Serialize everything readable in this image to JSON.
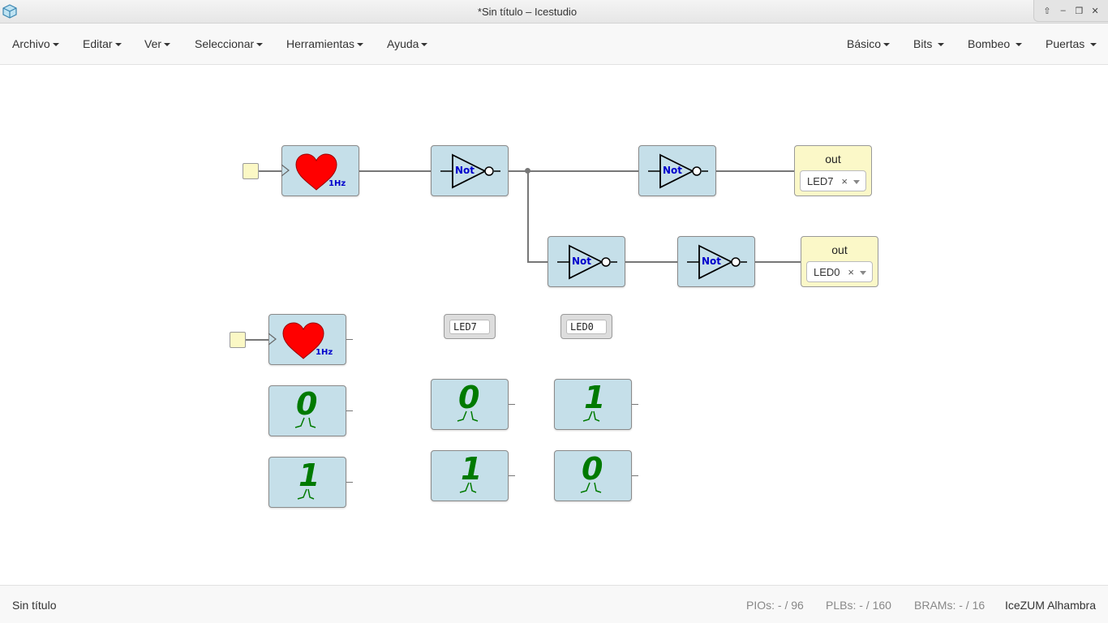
{
  "window": {
    "title": "*Sin título – Icestudio"
  },
  "controls": {
    "up": "⇧",
    "minimize": "–",
    "restore": "❐",
    "close": "✕"
  },
  "menu_left": [
    "Archivo",
    "Editar",
    "Ver",
    "Seleccionar",
    "Herramientas",
    "Ayuda"
  ],
  "menu_right": [
    "Básico",
    "Bits",
    "Bombeo",
    "Puertas"
  ],
  "blocks": {
    "not_label": "Not",
    "clock_freq": "1Hz",
    "output_label": "out",
    "const_zero": "0",
    "const_one": "1"
  },
  "outputs": [
    {
      "label": "out",
      "pin": "LED7"
    },
    {
      "label": "out",
      "pin": "LED0"
    }
  ],
  "labels": [
    "LED7",
    "LED0"
  ],
  "statusbar": {
    "filename": "Sin título",
    "pios_label": "PIOs:",
    "pios_value": "- / 96",
    "plbs_label": "PLBs:",
    "plbs_value": "- / 160",
    "brams_label": "BRAMs:",
    "brams_value": "- / 16",
    "board": "IceZUM Alhambra"
  },
  "colors": {
    "block": "#c5dfe9",
    "io_block": "#fbf8c8",
    "heart": "#ff0000",
    "not_text": "#0000cc",
    "const_text": "#007a00"
  }
}
